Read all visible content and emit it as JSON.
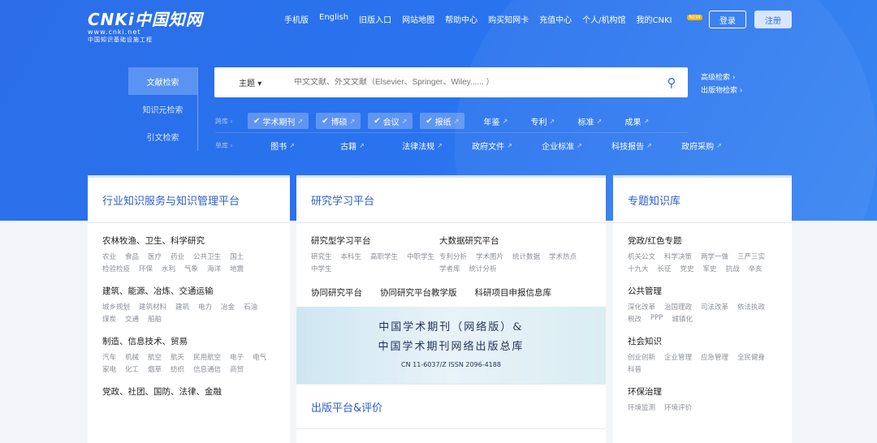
{
  "logo": {
    "main": "CNKi中国知网",
    "url": "www.cnki.net",
    "sub": "中国知识基础设施工程"
  },
  "nav": [
    "手机版",
    "English",
    "旧版入口",
    "网站地图",
    "帮助中心",
    "购买知网卡",
    "充值中心",
    "个人/机构馆",
    "我的CNKI"
  ],
  "nav_badge": "NEW",
  "login": "登录",
  "register": "注册",
  "left_tabs": [
    "文献检索",
    "知识元检索",
    "引文检索"
  ],
  "search": {
    "field": "主题",
    "placeholder": "中文文献、外文文献（Elsevier、Springer、Wiley...... ）"
  },
  "advanced": [
    "高级检索 ›",
    "出版物检索 ›"
  ],
  "cross_label": "跨库 ›",
  "cross_checked": [
    "学术期刊",
    "博硕",
    "会议",
    "报纸"
  ],
  "cross_other": [
    "年鉴",
    "专利",
    "标准",
    "成果"
  ],
  "single_label": "单库 ›",
  "single": [
    "图书",
    "古籍",
    "法律法规",
    "政府文件",
    "企业标准",
    "科技报告",
    "政府采购"
  ],
  "card1": {
    "title": "行业知识服务与知识管理平台",
    "sections": [
      {
        "h": "农林牧渔、卫生、科学研究",
        "tags": [
          "农业",
          "食品",
          "医疗",
          "药业",
          "公共卫生",
          "国土",
          "检验检疫",
          "环保",
          "水利",
          "气象",
          "海洋",
          "地震"
        ]
      },
      {
        "h": "建筑、能源、冶炼、交通运输",
        "tags": [
          "城乡规划",
          "建筑材料",
          "建筑",
          "电力",
          "冶金",
          "石油",
          "煤炭",
          "交通",
          "船舶"
        ]
      },
      {
        "h": "制造、信息技术、贸易",
        "tags": [
          "汽车",
          "机械",
          "航空",
          "航天",
          "民用航空",
          "电子",
          "电气",
          "家电",
          "化工",
          "烟草",
          "纺织",
          "信息通信",
          "商贸"
        ]
      },
      {
        "h": "党政、社团、国防、法律、金融",
        "tags": []
      }
    ]
  },
  "card2": {
    "title": "研究学习平台",
    "a": {
      "h": "研究型学习平台",
      "tags": [
        "研究生",
        "本科生",
        "高职学生",
        "中职学生",
        "中学生"
      ]
    },
    "b": {
      "h": "大数据研究平台",
      "tags": [
        "专利分析",
        "学术图片",
        "统计数据",
        "学术热点",
        "学者库",
        "统计分析"
      ]
    },
    "links": [
      "协同研究平台",
      "协同研究平台教学版",
      "科研项目申报信息库"
    ],
    "banner": {
      "l1": "中国学术期刊（网络版）&",
      "l2": "中国学术期刊网络出版总库",
      "issn": "CN 11-6037/Z    ISSN 2096-4188"
    },
    "title2": "出版平台&评价"
  },
  "card3": {
    "title": "专题知识库",
    "sections": [
      {
        "h": "党政/红色专题",
        "tags": [
          "机关公文",
          "科学决策",
          "两学一做",
          "三严三实",
          "十九大",
          "长征",
          "党史",
          "军史",
          "抗战",
          "辛亥"
        ]
      },
      {
        "h": "公共管理",
        "tags": [
          "深化改革",
          "治国理政",
          "司法改革",
          "依法执政",
          "税改",
          "PPP",
          "城镇化"
        ]
      },
      {
        "h": "社会知识",
        "tags": [
          "创业创新",
          "企业管理",
          "应急管理",
          "全民健身",
          "科普"
        ]
      },
      {
        "h": "环保治理",
        "tags": [
          "环境监测",
          "环境评价"
        ]
      }
    ]
  }
}
